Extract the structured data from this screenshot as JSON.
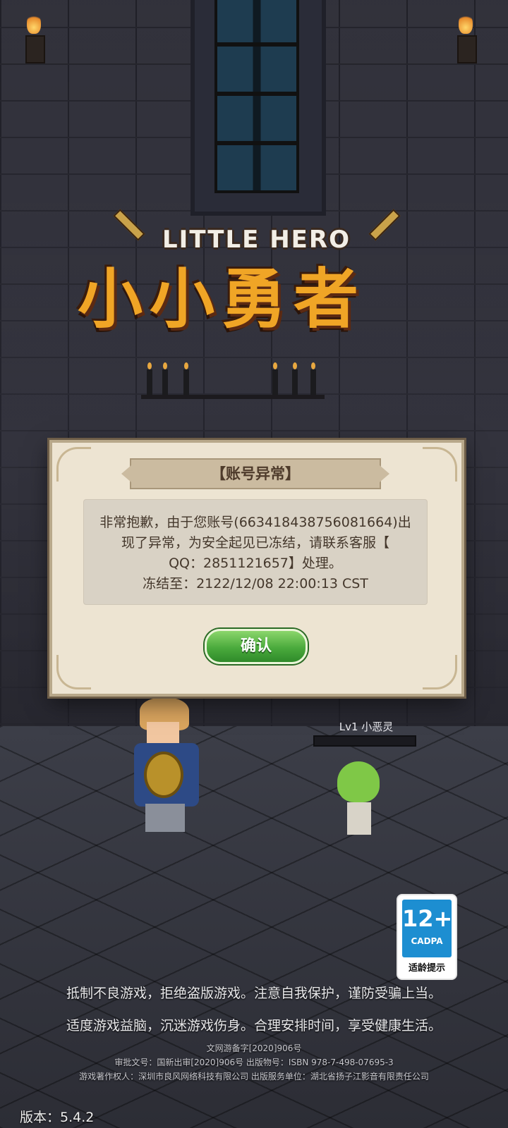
{
  "logo": {
    "subtitle": "LITTLE HERO",
    "title": "小小勇者"
  },
  "dialog": {
    "title": "【账号异常】",
    "message_lines": [
      "非常抱歉，由于您账号(663418438756081664)出",
      "现了异常，为安全起见已冻结，请联系客服【",
      "QQ：2851121657】处理。",
      "冻结至：2122/12/08 22:00:13 CST"
    ],
    "confirm_label": "确认"
  },
  "enemy": {
    "label": "Lv1 小恶灵"
  },
  "rating_badge": {
    "age": "12+",
    "org": "CADPA",
    "tip": "适龄提示"
  },
  "notices": [
    "抵制不良游戏，拒绝盗版游戏。注意自我保护，谨防受骗上当。",
    "适度游戏益脑，沉迷游戏伤身。合理安排时间，享受健康生活。"
  ],
  "license_lines": [
    "文网游备字[2020]906号",
    "审批文号：国新出审[2020]906号 出版物号：ISBN 978-7-498-07695-3",
    "游戏著作权人：深圳市良风网络科技有限公司 出版服务单位：湖北省扬子江影音有限责任公司"
  ],
  "version": "版本：5.4.2",
  "colors": {
    "dialog_bg": "#ede4d2",
    "confirm_green": "#4aaa3c",
    "logo_orange": "#f0a526",
    "badge_blue": "#1d8ed1"
  }
}
